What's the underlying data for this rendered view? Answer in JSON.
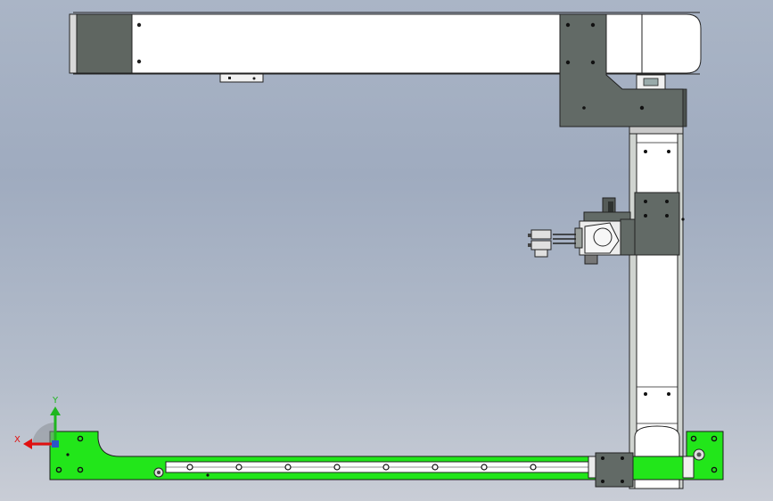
{
  "viewport": {
    "background_top": "#aab5c6",
    "background_bottom": "#c9cdd6"
  },
  "colors": {
    "base_plate": "#22e61a",
    "belt_white": "#ffffff",
    "steel_plate": "#626a66",
    "outline": "#1a1a1a",
    "axis_x": "#e01010",
    "axis_y": "#1fb61f"
  },
  "triad": {
    "x_label": "X",
    "y_label": "Y"
  },
  "icons": {
    "triad": "coordinate-triad-icon",
    "model": "cad-gantry-model"
  }
}
